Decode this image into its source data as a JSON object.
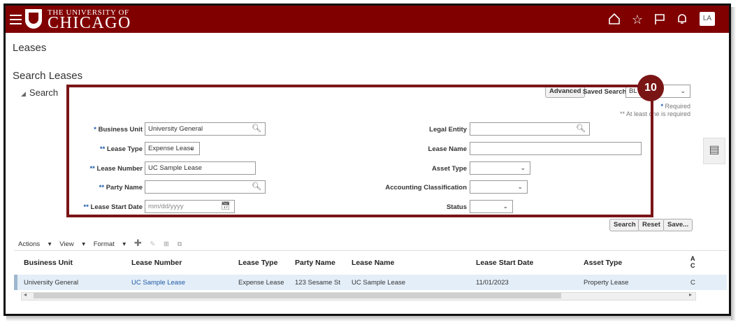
{
  "header": {
    "logo_line1": "THE UNIVERSITY OF",
    "logo_line2": "CHICAGO",
    "avatar_initials": "LA",
    "bg_color": "#800000"
  },
  "page": {
    "title": "Leases",
    "section_title": "Search Leases",
    "search_label": "Search"
  },
  "search": {
    "advanced_label": "Advanced",
    "saved_search_label": "Saved Search",
    "saved_search_value": "BL",
    "required_note": "Required",
    "at_least_note": "** At least one is required",
    "step_badge": "10",
    "fields": {
      "business_unit": {
        "label": "Business Unit",
        "marker": "*",
        "value": "University General"
      },
      "lease_type": {
        "label": "Lease Type",
        "marker": "**",
        "value": "Expense Lease"
      },
      "lease_number": {
        "label": "Lease Number",
        "marker": "**",
        "value": "UC Sample Lease"
      },
      "party_name": {
        "label": "Party Name",
        "marker": "**",
        "value": ""
      },
      "lease_start_date": {
        "label": "Lease Start Date",
        "marker": "**",
        "placeholder": "mm/dd/yyyy"
      },
      "legal_entity": {
        "label": "Legal Entity",
        "value": ""
      },
      "lease_name": {
        "label": "Lease Name",
        "value": ""
      },
      "asset_type": {
        "label": "Asset Type",
        "value": ""
      },
      "accounting_classification": {
        "label": "Accounting Classification",
        "value": ""
      },
      "status": {
        "label": "Status",
        "value": ""
      }
    },
    "buttons": {
      "search": "Search",
      "reset": "Reset",
      "save": "Save..."
    }
  },
  "toolbar": {
    "actions": "Actions",
    "view": "View",
    "format": "Format"
  },
  "table": {
    "columns": [
      "Business Unit",
      "Lease Number",
      "Lease Type",
      "Party Name",
      "Lease Name",
      "Lease Start Date",
      "Asset Type",
      "A C"
    ],
    "rows": [
      [
        "University General",
        "UC Sample Lease",
        "Expense Lease",
        "123 Sesame St",
        "UC Sample Lease",
        "11/01/2023",
        "Property Lease",
        "C"
      ]
    ]
  }
}
